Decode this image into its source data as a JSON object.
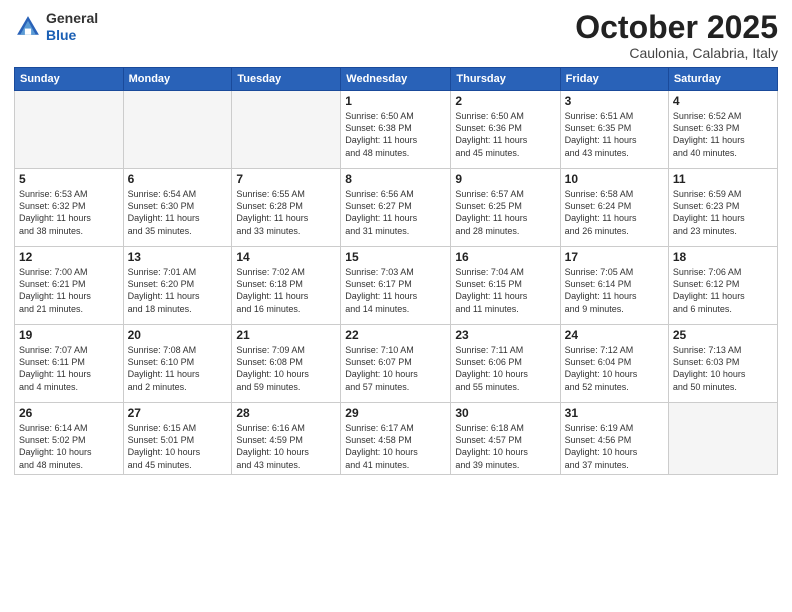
{
  "logo": {
    "general": "General",
    "blue": "Blue"
  },
  "header": {
    "month": "October 2025",
    "location": "Caulonia, Calabria, Italy"
  },
  "weekdays": [
    "Sunday",
    "Monday",
    "Tuesday",
    "Wednesday",
    "Thursday",
    "Friday",
    "Saturday"
  ],
  "weeks": [
    [
      {
        "day": "",
        "info": ""
      },
      {
        "day": "",
        "info": ""
      },
      {
        "day": "",
        "info": ""
      },
      {
        "day": "1",
        "info": "Sunrise: 6:50 AM\nSunset: 6:38 PM\nDaylight: 11 hours\nand 48 minutes."
      },
      {
        "day": "2",
        "info": "Sunrise: 6:50 AM\nSunset: 6:36 PM\nDaylight: 11 hours\nand 45 minutes."
      },
      {
        "day": "3",
        "info": "Sunrise: 6:51 AM\nSunset: 6:35 PM\nDaylight: 11 hours\nand 43 minutes."
      },
      {
        "day": "4",
        "info": "Sunrise: 6:52 AM\nSunset: 6:33 PM\nDaylight: 11 hours\nand 40 minutes."
      }
    ],
    [
      {
        "day": "5",
        "info": "Sunrise: 6:53 AM\nSunset: 6:32 PM\nDaylight: 11 hours\nand 38 minutes."
      },
      {
        "day": "6",
        "info": "Sunrise: 6:54 AM\nSunset: 6:30 PM\nDaylight: 11 hours\nand 35 minutes."
      },
      {
        "day": "7",
        "info": "Sunrise: 6:55 AM\nSunset: 6:28 PM\nDaylight: 11 hours\nand 33 minutes."
      },
      {
        "day": "8",
        "info": "Sunrise: 6:56 AM\nSunset: 6:27 PM\nDaylight: 11 hours\nand 31 minutes."
      },
      {
        "day": "9",
        "info": "Sunrise: 6:57 AM\nSunset: 6:25 PM\nDaylight: 11 hours\nand 28 minutes."
      },
      {
        "day": "10",
        "info": "Sunrise: 6:58 AM\nSunset: 6:24 PM\nDaylight: 11 hours\nand 26 minutes."
      },
      {
        "day": "11",
        "info": "Sunrise: 6:59 AM\nSunset: 6:23 PM\nDaylight: 11 hours\nand 23 minutes."
      }
    ],
    [
      {
        "day": "12",
        "info": "Sunrise: 7:00 AM\nSunset: 6:21 PM\nDaylight: 11 hours\nand 21 minutes."
      },
      {
        "day": "13",
        "info": "Sunrise: 7:01 AM\nSunset: 6:20 PM\nDaylight: 11 hours\nand 18 minutes."
      },
      {
        "day": "14",
        "info": "Sunrise: 7:02 AM\nSunset: 6:18 PM\nDaylight: 11 hours\nand 16 minutes."
      },
      {
        "day": "15",
        "info": "Sunrise: 7:03 AM\nSunset: 6:17 PM\nDaylight: 11 hours\nand 14 minutes."
      },
      {
        "day": "16",
        "info": "Sunrise: 7:04 AM\nSunset: 6:15 PM\nDaylight: 11 hours\nand 11 minutes."
      },
      {
        "day": "17",
        "info": "Sunrise: 7:05 AM\nSunset: 6:14 PM\nDaylight: 11 hours\nand 9 minutes."
      },
      {
        "day": "18",
        "info": "Sunrise: 7:06 AM\nSunset: 6:12 PM\nDaylight: 11 hours\nand 6 minutes."
      }
    ],
    [
      {
        "day": "19",
        "info": "Sunrise: 7:07 AM\nSunset: 6:11 PM\nDaylight: 11 hours\nand 4 minutes."
      },
      {
        "day": "20",
        "info": "Sunrise: 7:08 AM\nSunset: 6:10 PM\nDaylight: 11 hours\nand 2 minutes."
      },
      {
        "day": "21",
        "info": "Sunrise: 7:09 AM\nSunset: 6:08 PM\nDaylight: 10 hours\nand 59 minutes."
      },
      {
        "day": "22",
        "info": "Sunrise: 7:10 AM\nSunset: 6:07 PM\nDaylight: 10 hours\nand 57 minutes."
      },
      {
        "day": "23",
        "info": "Sunrise: 7:11 AM\nSunset: 6:06 PM\nDaylight: 10 hours\nand 55 minutes."
      },
      {
        "day": "24",
        "info": "Sunrise: 7:12 AM\nSunset: 6:04 PM\nDaylight: 10 hours\nand 52 minutes."
      },
      {
        "day": "25",
        "info": "Sunrise: 7:13 AM\nSunset: 6:03 PM\nDaylight: 10 hours\nand 50 minutes."
      }
    ],
    [
      {
        "day": "26",
        "info": "Sunrise: 6:14 AM\nSunset: 5:02 PM\nDaylight: 10 hours\nand 48 minutes."
      },
      {
        "day": "27",
        "info": "Sunrise: 6:15 AM\nSunset: 5:01 PM\nDaylight: 10 hours\nand 45 minutes."
      },
      {
        "day": "28",
        "info": "Sunrise: 6:16 AM\nSunset: 4:59 PM\nDaylight: 10 hours\nand 43 minutes."
      },
      {
        "day": "29",
        "info": "Sunrise: 6:17 AM\nSunset: 4:58 PM\nDaylight: 10 hours\nand 41 minutes."
      },
      {
        "day": "30",
        "info": "Sunrise: 6:18 AM\nSunset: 4:57 PM\nDaylight: 10 hours\nand 39 minutes."
      },
      {
        "day": "31",
        "info": "Sunrise: 6:19 AM\nSunset: 4:56 PM\nDaylight: 10 hours\nand 37 minutes."
      },
      {
        "day": "",
        "info": ""
      }
    ]
  ]
}
